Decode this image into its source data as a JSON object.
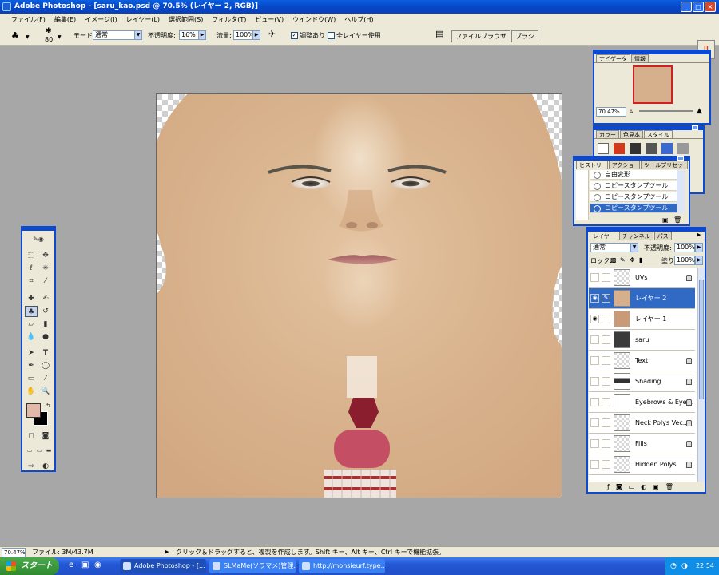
{
  "window": {
    "title": "Adobe Photoshop - [saru_kao.psd @ 70.5% (レイヤー 2, RGB)]"
  },
  "menu": [
    "ファイル(F)",
    "編集(E)",
    "イメージ(I)",
    "レイヤー(L)",
    "選択範囲(S)",
    "フィルタ(T)",
    "ビュー(V)",
    "ウインドウ(W)",
    "ヘルプ(H)"
  ],
  "options": {
    "brush_size": "80",
    "mode_label": "モード:",
    "mode_value": "通常",
    "opacity_label": "不透明度:",
    "opacity_value": "16%",
    "flow_label": "流量:",
    "flow_value": "100%",
    "aligned_label": "調整あり",
    "all_layers_label": "全レイヤー使用",
    "tabs": [
      "ファイルブラウザ",
      "ブラシ"
    ]
  },
  "navigator": {
    "tabs": [
      "ナビゲータ",
      "情報"
    ],
    "zoom": "70.47%"
  },
  "color_panel": {
    "tabs": [
      "カラー",
      "色見本",
      "スタイル"
    ]
  },
  "history": {
    "tabs": [
      "ヒストリー",
      "アクション",
      "ツールプリセット"
    ],
    "items": [
      "自由変形",
      "コピースタンプツール",
      "コピースタンプツール",
      "コピースタンプツール"
    ]
  },
  "layers": {
    "tabs": [
      "レイヤー",
      "チャンネル",
      "パス"
    ],
    "blend_mode": "通常",
    "opacity_label": "不透明度:",
    "opacity_value": "100%",
    "lock_label": "ロック:",
    "fill_label": "塗り:",
    "fill_value": "100%",
    "items": [
      {
        "name": "UVs",
        "visible": false,
        "locked": true
      },
      {
        "name": "レイヤー 2",
        "visible": true,
        "selected": true
      },
      {
        "name": "レイヤー 1",
        "visible": true
      },
      {
        "name": "saru",
        "visible": false
      },
      {
        "name": "Text",
        "visible": false,
        "locked": true
      },
      {
        "name": "Shading",
        "visible": false,
        "locked": true
      },
      {
        "name": "Eyebrows & Eye...",
        "visible": false,
        "locked": true
      },
      {
        "name": "Neck Polys Vec...",
        "visible": false,
        "locked": true
      },
      {
        "name": "Fills",
        "visible": false,
        "locked": true
      },
      {
        "name": "Hidden Polys",
        "visible": false,
        "locked": true
      }
    ]
  },
  "status": {
    "zoom": "70.47%",
    "file_info": "ファイル: 3M/43.7M",
    "hint": "クリック＆ドラッグすると、複製を作成します。Shift キー、Alt キー、Ctrl キーで機能拡張。"
  },
  "taskbar": {
    "start_label": "スタート",
    "tasks": [
      "Adobe Photoshop - [...",
      "SLMaMe(ソラマメ)管理...",
      "http://monsieurf.type..."
    ],
    "clock": "22:54"
  },
  "colors": {
    "title_blue": "#0648c8",
    "skin": "#d6b08c",
    "selection": "#316ac5",
    "foreground_swatch": "#e2b8a8"
  }
}
